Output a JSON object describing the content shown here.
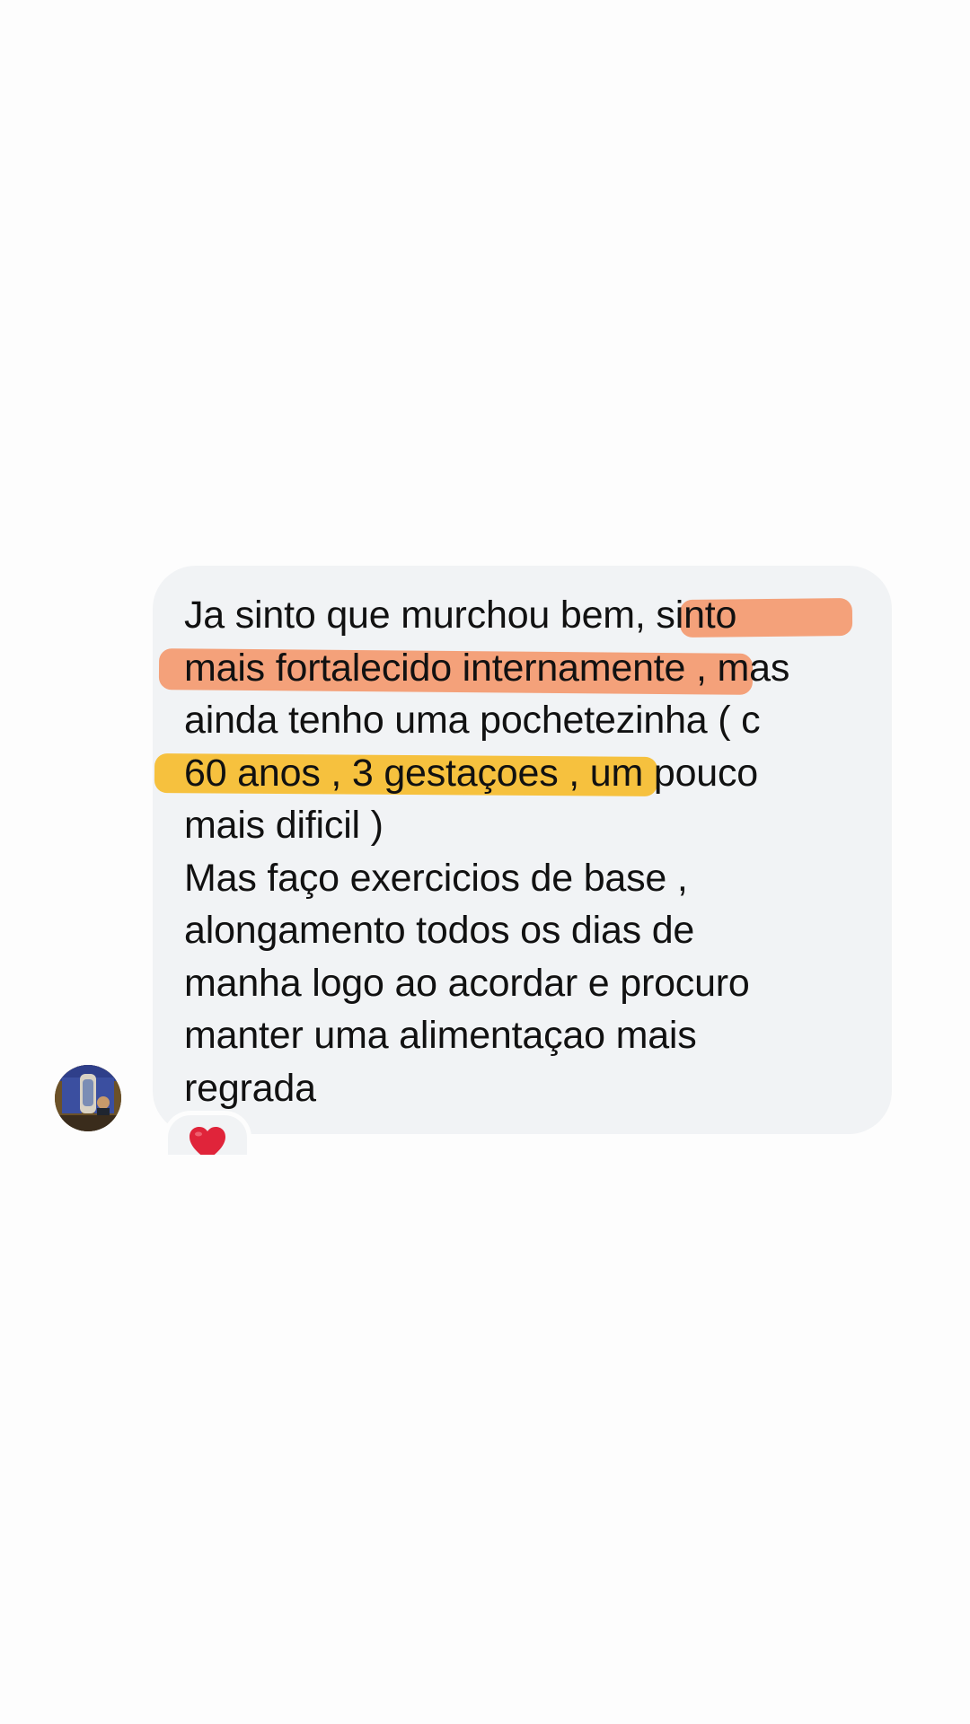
{
  "conversation": {
    "message": {
      "lines": [
        "Ja sinto que murchou bem, sinto",
        "mais fortalecido internamente , mas",
        "ainda tenho uma pochetezinha ( c",
        "60 anos , 3 gestaçoes , um pouco",
        "mais dificil )",
        "Mas faço exercicios de base ,",
        "alongamento todos os dias de",
        "manha logo ao acordar e procuro",
        "manter uma alimentaçao mais",
        "regrada"
      ],
      "highlights": [
        {
          "text": ", sinto",
          "color": "#f4a17a"
        },
        {
          "text": "mais fortalecido internamente",
          "color": "#f4a17a"
        },
        {
          "text": "60 anos , 3 gestaçoes , u",
          "color": "#f6c13e"
        }
      ]
    },
    "reaction": {
      "icon": "heart-icon",
      "color": "#e0243a"
    },
    "avatar": {
      "icon": "avatar-image"
    },
    "colors": {
      "background": "#fdfdfd",
      "bubble": "#f1f3f5",
      "text": "#111111"
    }
  }
}
